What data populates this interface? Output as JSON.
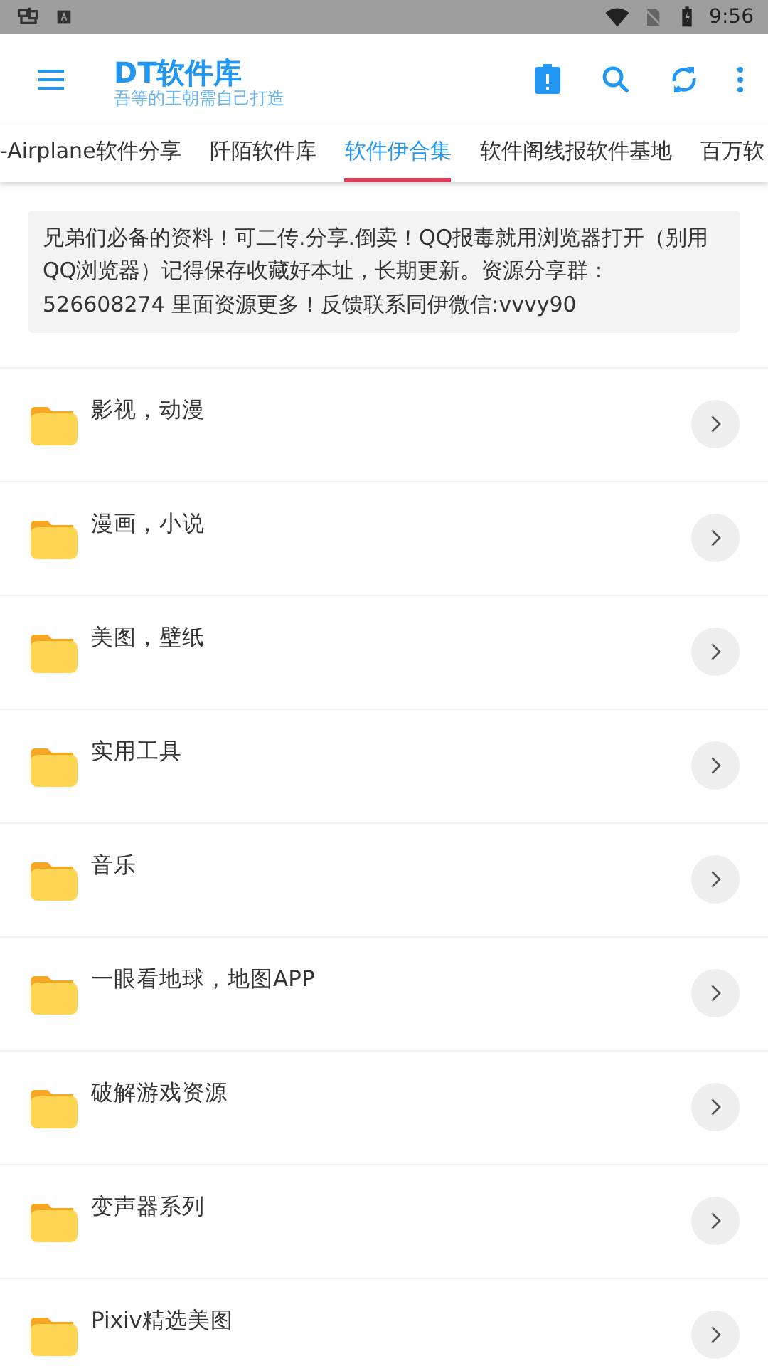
{
  "status_bar": {
    "time": "9:56"
  },
  "app_bar": {
    "title": "DT软件库",
    "subtitle": "吾等的王朝需自己打造"
  },
  "tabs": [
    {
      "label": "-Airplane软件分享",
      "selected": false
    },
    {
      "label": "阡陌软件库",
      "selected": false
    },
    {
      "label": "软件伊合集",
      "selected": true
    },
    {
      "label": "软件阁线报软件基地",
      "selected": false
    },
    {
      "label": "百万软",
      "selected": false
    }
  ],
  "notice": "兄弟们必备的资料！可二传.分享.倒卖！QQ报毒就用浏览器打开（别用QQ浏览器）记得保存收藏好本址，长期更新。资源分享群：526608274 里面资源更多！反馈联系同伊微信:vvvy90",
  "folders": [
    {
      "name": "影视，动漫"
    },
    {
      "name": "漫画，小说"
    },
    {
      "name": "美图，壁纸"
    },
    {
      "name": "实用工具"
    },
    {
      "name": "音乐"
    },
    {
      "name": "一眼看地球，地图APP"
    },
    {
      "name": "破解游戏资源"
    },
    {
      "name": "变声器系列"
    },
    {
      "name": "Pixiv精选美图"
    }
  ]
}
